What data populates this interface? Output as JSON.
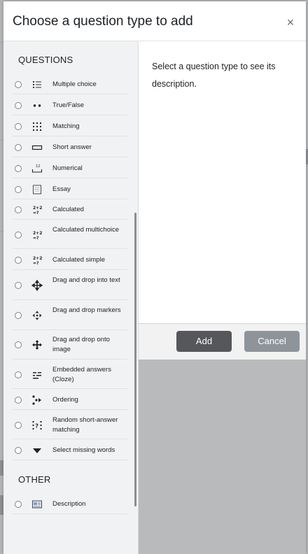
{
  "modal": {
    "title": "Choose a question type to add",
    "close_symbol": "×"
  },
  "sections": {
    "questions_label": "QUESTIONS",
    "other_label": "OTHER"
  },
  "question_types": [
    {
      "label": "Multiple choice",
      "icon": "list-bullets-icon"
    },
    {
      "label": "True/False",
      "icon": "two-dots-icon"
    },
    {
      "label": "Matching",
      "icon": "grid-dots-icon"
    },
    {
      "label": "Short answer",
      "icon": "text-box-icon"
    },
    {
      "label": "Numerical",
      "icon": "numerical-icon"
    },
    {
      "label": "Essay",
      "icon": "essay-icon"
    },
    {
      "label": "Calculated",
      "icon": "calculated-icon"
    },
    {
      "label": "Calculated multichoice",
      "icon": "calculated-multichoice-icon"
    },
    {
      "label": "Calculated simple",
      "icon": "calculated-simple-icon"
    },
    {
      "label": "Drag and drop into text",
      "icon": "move-arrows-icon"
    },
    {
      "label": "Drag and drop markers",
      "icon": "move-markers-icon"
    },
    {
      "label": "Drag and drop onto image",
      "icon": "move-cross-icon"
    },
    {
      "label": "Embedded answers (Cloze)",
      "icon": "cloze-icon"
    },
    {
      "label": "Ordering",
      "icon": "ordering-icon"
    },
    {
      "label": "Random short-answer matching",
      "icon": "random-matching-icon"
    },
    {
      "label": "Select missing words",
      "icon": "caret-down-icon"
    }
  ],
  "other_types": [
    {
      "label": "Description",
      "icon": "description-icon"
    }
  ],
  "description_panel": {
    "text": "Select a question type to see its description."
  },
  "footer": {
    "add_label": "Add",
    "cancel_label": "Cancel"
  }
}
